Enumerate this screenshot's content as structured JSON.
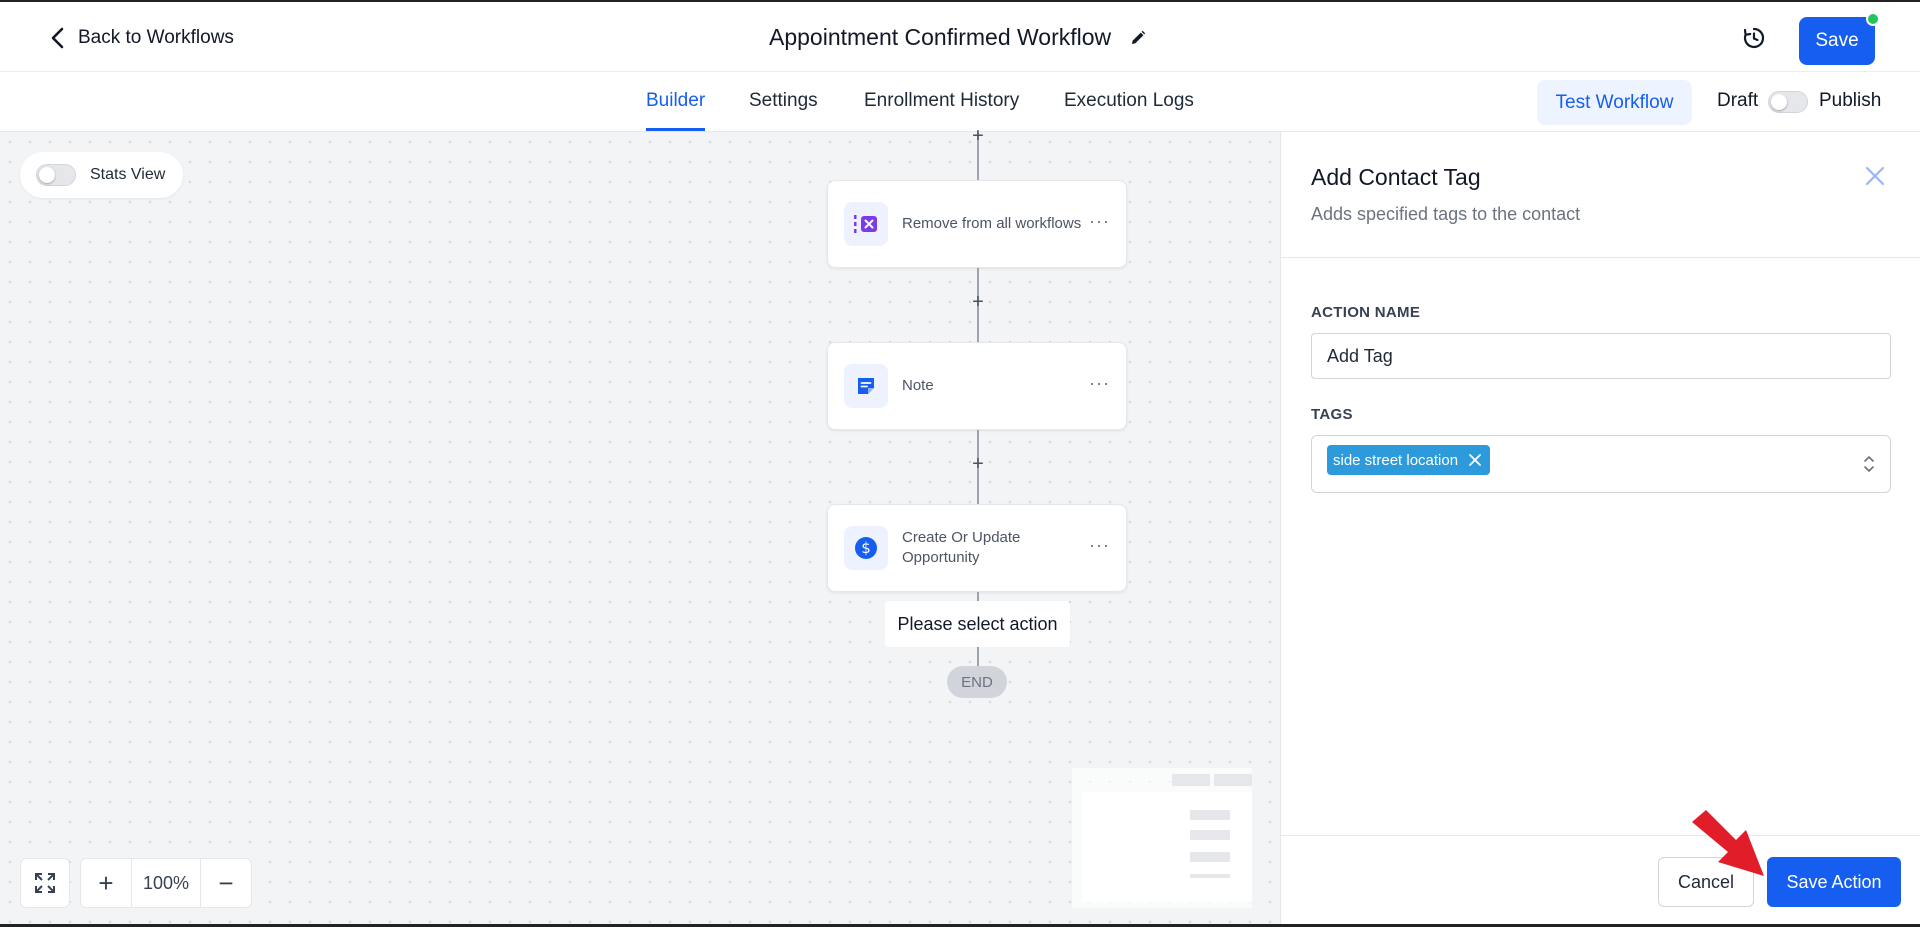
{
  "header": {
    "back_label": "Back to Workflows",
    "title": "Appointment Confirmed Workflow",
    "save_label": "Save"
  },
  "tabs": [
    {
      "label": "Builder",
      "active": true
    },
    {
      "label": "Settings",
      "active": false
    },
    {
      "label": "Enrollment History",
      "active": false
    },
    {
      "label": "Execution Logs",
      "active": false
    }
  ],
  "tabs_right": {
    "test_label": "Test Workflow",
    "draft_label": "Draft",
    "publish_label": "Publish",
    "published": false
  },
  "canvas": {
    "stats_label": "Stats View",
    "stats_enabled": false,
    "nodes": [
      {
        "label": "Remove from all workflows",
        "icon": "remove-workflow-icon"
      },
      {
        "label": "Note",
        "icon": "note-icon"
      },
      {
        "label": "Create Or Update Opportunity",
        "icon": "dollar-icon"
      }
    ],
    "select_action_label": "Please select action",
    "end_label": "END",
    "zoom_level": "100%"
  },
  "panel": {
    "title": "Add Contact Tag",
    "subtitle": "Adds specified tags to the contact",
    "action_name_label": "ACTION NAME",
    "action_name_value": "Add Tag",
    "tags_label": "TAGS",
    "tags": [
      "side street location"
    ],
    "cancel_label": "Cancel",
    "save_action_label": "Save Action"
  },
  "colors": {
    "primary": "#155eef",
    "tag_chip": "#2d9bdb",
    "status_dot": "#22c55e",
    "annotation_arrow": "#e11d2a"
  }
}
